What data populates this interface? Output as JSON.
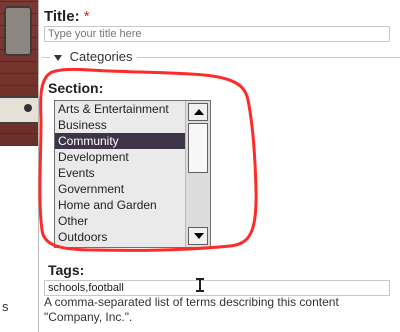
{
  "left_panel": {
    "char": "s"
  },
  "form": {
    "title_label": "Title:",
    "required_mark": "*",
    "title_placeholder": "Type your title here",
    "categories_legend": "Categories",
    "section_label": "Section:",
    "section_items": [
      "Arts & Entertainment",
      "Business",
      "Community",
      "Development",
      "Events",
      "Government",
      "Home and Garden",
      "Other",
      "Outdoors"
    ],
    "selected_section": "Community",
    "tags_label": "Tags:",
    "tags_value": "schools,football",
    "tags_help": "A comma-separated list of terms describing this content",
    "tags_help_2": "\"Company, Inc.\"."
  },
  "colors": {
    "annotation": "#ff2a2a",
    "selection_bg": "#3d3447"
  }
}
